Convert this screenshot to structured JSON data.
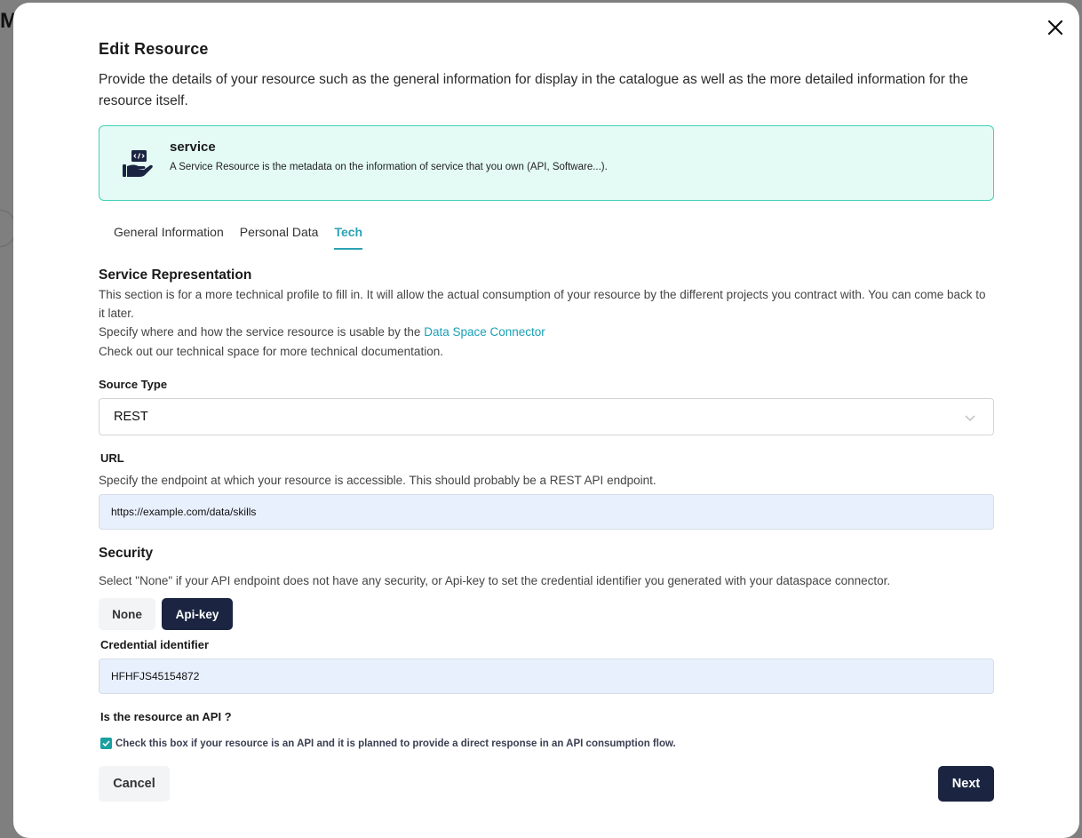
{
  "background": {
    "letter": "M"
  },
  "modal": {
    "title": "Edit Resource",
    "description": "Provide the details of your resource such as the general information for display in the catalogue as well as the more detailed information for the resource itself."
  },
  "resource_type": {
    "name": "service",
    "description": "A Service Resource is the metadata on the information of service that you own (API, Software...).",
    "icon": "hand-holding-code-icon"
  },
  "tabs": [
    {
      "label": "General Information",
      "active": false
    },
    {
      "label": "Personal Data",
      "active": false
    },
    {
      "label": "Tech",
      "active": true
    }
  ],
  "service_representation": {
    "title": "Service Representation",
    "text1": "This section is for a more technical profile to fill in. It will allow the actual consumption of your resource by the different projects you contract with. You can come back to it later.",
    "text2_prefix": "Specify where and how the service resource is usable by the",
    "text2_link": "Data Space Connector",
    "text3": "Check out our technical space for more technical documentation."
  },
  "source_type": {
    "label": "Source Type",
    "value": "REST"
  },
  "url": {
    "label": "URL",
    "help": "Specify the endpoint at which your resource is accessible. This should probably be a REST API endpoint.",
    "value": "https://example.com/data/skills"
  },
  "security": {
    "title": "Security",
    "help": "Select \"None\" if your API endpoint does not have any security, or Api-key to set the credential identifier you generated with your dataspace connector.",
    "options": [
      "None",
      "Api-key"
    ],
    "selected": "Api-key"
  },
  "credential": {
    "label": "Credential identifier",
    "value": "HFHFJS45154872"
  },
  "api_question": {
    "label": "Is the resource an API ?",
    "checkbox_text": "Check this box if your resource is an API and it is planned to provide a direct response in an API consumption flow.",
    "checked": true
  },
  "actions": {
    "cancel": "Cancel",
    "next": "Next"
  },
  "colors": {
    "accent": "#2aa3b3",
    "dark_button": "#1b2541",
    "card_bg": "#e4fbf5",
    "card_border": "#43d0b7",
    "input_bg": "#e8effd"
  }
}
